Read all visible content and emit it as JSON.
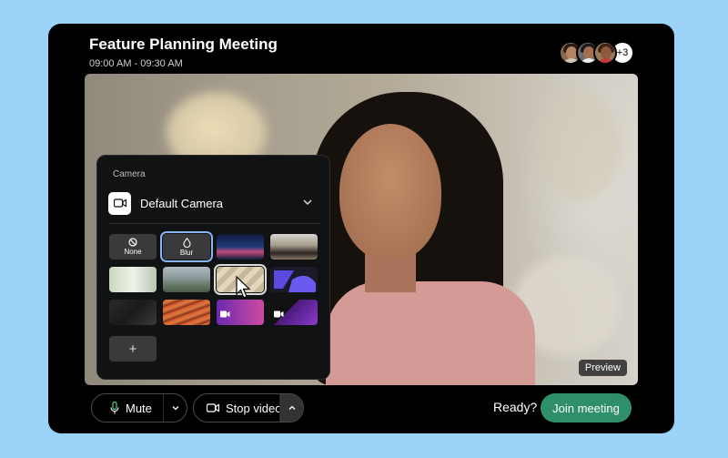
{
  "meeting": {
    "title": "Feature Planning Meeting",
    "time": "09:00 AM - 09:30 AM",
    "participants_more": "+3"
  },
  "preview": {
    "badge": "Preview"
  },
  "camera_panel": {
    "label": "Camera",
    "selected_camera": "Default Camera",
    "tiles": [
      {
        "label": "None",
        "icon": "no-symbol-icon"
      },
      {
        "label": "Blur",
        "icon": "droplet-icon",
        "selected": true
      }
    ],
    "add_label": "+"
  },
  "controls": {
    "mute_label": "Mute",
    "stop_video_label": "Stop video",
    "ready_text": "Ready?",
    "join_label": "Join meeting"
  },
  "colors": {
    "page_bg": "#9cd3f8",
    "window_bg": "#000000",
    "join_button": "#2f8f68",
    "selected_outline": "#8ab4f8"
  }
}
